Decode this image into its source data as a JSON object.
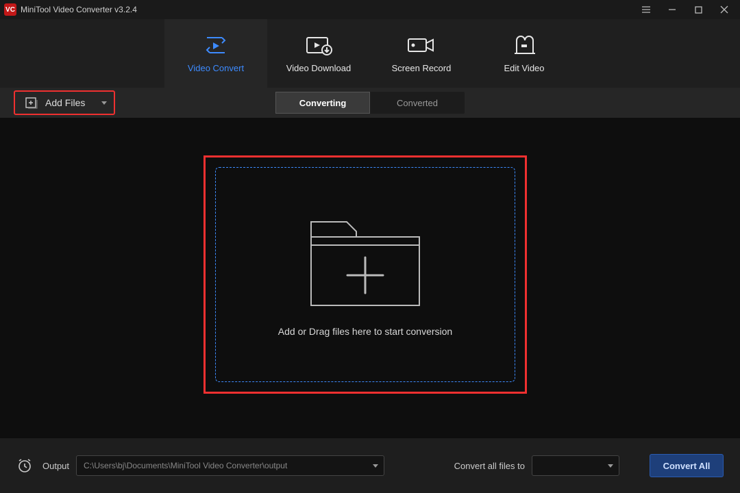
{
  "titlebar": {
    "title": "MiniTool Video Converter v3.2.4"
  },
  "nav": {
    "convert": "Video Convert",
    "download": "Video Download",
    "record": "Screen Record",
    "edit": "Edit Video"
  },
  "toolbar": {
    "add_files": "Add Files",
    "seg_converting": "Converting",
    "seg_converted": "Converted"
  },
  "drop": {
    "hint": "Add or Drag files here to start conversion"
  },
  "bottom": {
    "output_label": "Output",
    "output_path": "C:\\Users\\bj\\Documents\\MiniTool Video Converter\\output",
    "convert_to_label": "Convert all files to",
    "convert_all": "Convert All"
  }
}
